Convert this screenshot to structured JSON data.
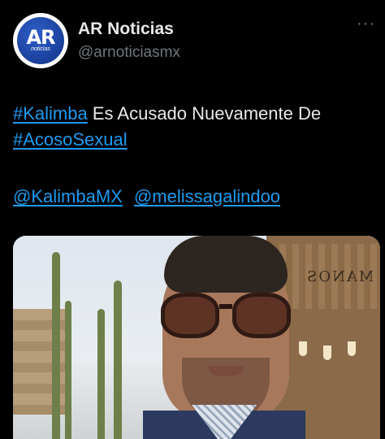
{
  "account": {
    "display_name": "AR Noticias",
    "handle": "@arnoticiasmx",
    "avatar_text": "AR",
    "avatar_subtext": "noticias"
  },
  "more_label": "···",
  "tweet": {
    "hashtag1": "#Kalimba",
    "text_part1": " Es Acusado Nuevamente De ",
    "hashtag2": "#AcosoSexual",
    "mention1": "@KalimbaMX",
    "mention2": "@melissagalindoo"
  },
  "media": {
    "sign_text": "MANOS"
  },
  "colors": {
    "background": "#000000",
    "text": "#e7e9ea",
    "muted": "#71767b",
    "link": "#1d9bf0"
  }
}
